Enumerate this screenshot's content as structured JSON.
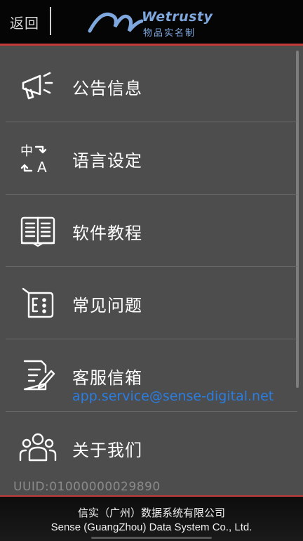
{
  "header": {
    "back_label": "返回",
    "logo_word": "Wetrusty",
    "logo_sub": "物品实名制"
  },
  "menu": {
    "items": [
      {
        "label": "公告信息",
        "icon": "megaphone-icon"
      },
      {
        "label": "语言设定",
        "icon": "translate-icon"
      },
      {
        "label": "软件教程",
        "icon": "book-icon"
      },
      {
        "label": "常见问题",
        "icon": "faq-icon"
      },
      {
        "label": "客服信箱",
        "icon": "mail-edit-icon"
      },
      {
        "label": "关于我们",
        "icon": "people-icon"
      }
    ],
    "email": "app.service@sense-digital.net"
  },
  "uuid": "UUID:01000000029890",
  "footer": {
    "line1": "信实（广州）数据系统有限公司",
    "line2": "Sense (GuangZhou) Data System Co., Ltd."
  },
  "colors": {
    "background": "#4d4d4d",
    "accent_red": "#c23a3a",
    "link_blue": "#2a7de1",
    "logo_blue": "#7ea7dd"
  }
}
